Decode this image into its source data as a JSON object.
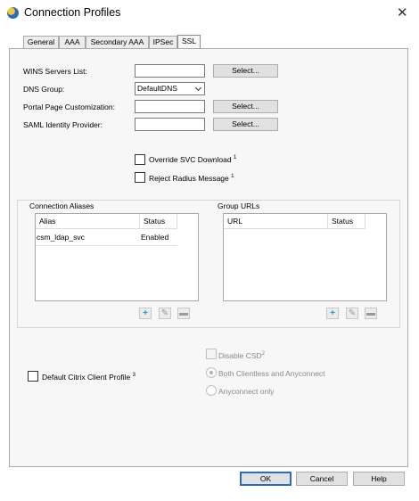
{
  "window": {
    "title": "Connection Profiles",
    "close_glyph": "✕"
  },
  "tabs": [
    {
      "label": "General"
    },
    {
      "label": "AAA"
    },
    {
      "label": "Secondary AAA"
    },
    {
      "label": "IPSec"
    },
    {
      "label": "SSL",
      "active": true
    }
  ],
  "form": {
    "wins_label": "WINS Servers List:",
    "wins_value": "",
    "wins_button": "Select...",
    "dns_label": "DNS Group:",
    "dns_value": "DefaultDNS",
    "portal_label": "Portal Page Customization:",
    "portal_value": "",
    "portal_button": "Select...",
    "saml_label": "SAML Identity Provider:",
    "saml_value": "",
    "saml_button": "Select..."
  },
  "options": {
    "override_label": "Override SVC Download",
    "override_sup": "1",
    "reject_label": "Reject Radius Message",
    "reject_sup": "1"
  },
  "aliases": {
    "title": "Connection Aliases",
    "columns": [
      "Alias",
      "Status"
    ],
    "rows": [
      {
        "alias": "csm_ldap_svc",
        "status": "Enabled"
      }
    ]
  },
  "group_urls": {
    "title": "Group URLs",
    "columns": [
      "URL",
      "Status"
    ],
    "rows": []
  },
  "citrix": {
    "label": "Default Citrix Client Profile",
    "sup": "3"
  },
  "csd": {
    "disable_label": "Disable CSD",
    "disable_sup": "2",
    "both_label": "Both Clientless and Anyconnect",
    "anyconnect_label": "Anyconnect only"
  },
  "buttons": {
    "ok": "OK",
    "cancel": "Cancel",
    "help": "Help"
  },
  "icons": {
    "add": "plus-icon",
    "edit": "pencil-icon",
    "delete": "trash-icon"
  },
  "colors": {
    "accent": "#2b95d6",
    "default_button_border": "#2b6cbc"
  }
}
